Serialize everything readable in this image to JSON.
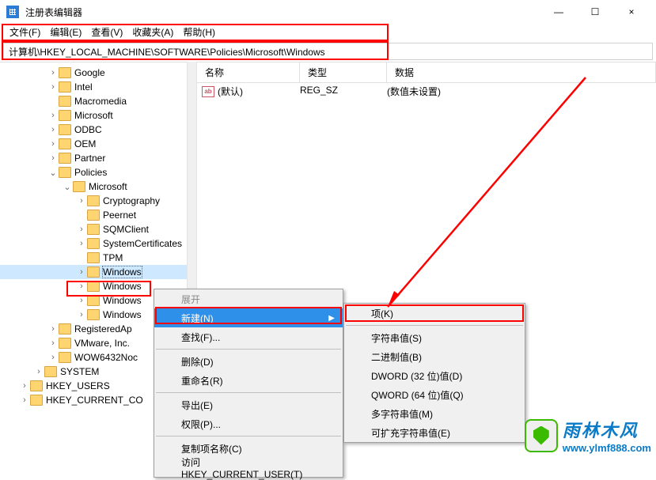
{
  "window": {
    "title": "注册表编辑器",
    "min": "—",
    "max": "☐",
    "close": "×"
  },
  "menu": {
    "file": "文件(F)",
    "edit": "编辑(E)",
    "view": "查看(V)",
    "fav": "收藏夹(A)",
    "help": "帮助(H)"
  },
  "address": "计算机\\HKEY_LOCAL_MACHINE\\SOFTWARE\\Policies\\Microsoft\\Windows",
  "tree": [
    {
      "indent": 60,
      "exp": ">",
      "label": "Google"
    },
    {
      "indent": 60,
      "exp": ">",
      "label": "Intel"
    },
    {
      "indent": 60,
      "exp": "",
      "label": "Macromedia"
    },
    {
      "indent": 60,
      "exp": ">",
      "label": "Microsoft"
    },
    {
      "indent": 60,
      "exp": ">",
      "label": "ODBC"
    },
    {
      "indent": 60,
      "exp": ">",
      "label": "OEM"
    },
    {
      "indent": 60,
      "exp": ">",
      "label": "Partner"
    },
    {
      "indent": 60,
      "exp": "v",
      "label": "Policies"
    },
    {
      "indent": 78,
      "exp": "v",
      "label": "Microsoft"
    },
    {
      "indent": 96,
      "exp": ">",
      "label": "Cryptography"
    },
    {
      "indent": 96,
      "exp": "",
      "label": "Peernet"
    },
    {
      "indent": 96,
      "exp": ">",
      "label": "SQMClient"
    },
    {
      "indent": 96,
      "exp": ">",
      "label": "SystemCertificates"
    },
    {
      "indent": 96,
      "exp": "",
      "label": "TPM"
    },
    {
      "indent": 96,
      "exp": ">",
      "label": "Windows",
      "sel": true
    },
    {
      "indent": 96,
      "exp": ">",
      "label": "Windows"
    },
    {
      "indent": 96,
      "exp": ">",
      "label": "Windows"
    },
    {
      "indent": 96,
      "exp": ">",
      "label": "Windows"
    },
    {
      "indent": 60,
      "exp": ">",
      "label": "RegisteredAp"
    },
    {
      "indent": 60,
      "exp": ">",
      "label": "VMware, Inc."
    },
    {
      "indent": 60,
      "exp": ">",
      "label": "WOW6432Noc"
    },
    {
      "indent": 42,
      "exp": ">",
      "label": "SYSTEM"
    },
    {
      "indent": 24,
      "exp": ">",
      "label": "HKEY_USERS"
    },
    {
      "indent": 24,
      "exp": ">",
      "label": "HKEY_CURRENT_CO"
    }
  ],
  "list": {
    "h1": "名称",
    "h2": "类型",
    "h3": "数据",
    "row": {
      "name": "(默认)",
      "type": "REG_SZ",
      "data": "(数值未设置)"
    }
  },
  "ctx1": [
    {
      "label": "展开",
      "dis": true
    },
    {
      "label": "新建(N)",
      "hl": true,
      "arrow": true
    },
    {
      "label": "查找(F)..."
    },
    {
      "sep": true
    },
    {
      "label": "删除(D)"
    },
    {
      "label": "重命名(R)"
    },
    {
      "sep": true
    },
    {
      "label": "导出(E)"
    },
    {
      "label": "权限(P)..."
    },
    {
      "sep": true
    },
    {
      "label": "复制项名称(C)"
    },
    {
      "label": "访问 HKEY_CURRENT_USER(T)"
    }
  ],
  "ctx2": [
    {
      "label": "项(K)"
    },
    {
      "sep": true
    },
    {
      "label": "字符串值(S)"
    },
    {
      "label": "二进制值(B)"
    },
    {
      "label": "DWORD (32 位)值(D)"
    },
    {
      "label": "QWORD (64 位)值(Q)"
    },
    {
      "label": "多字符串值(M)"
    },
    {
      "label": "可扩充字符串值(E)"
    }
  ],
  "watermark": {
    "brand": "雨林木风",
    "url": "www.ylmf888.com"
  }
}
